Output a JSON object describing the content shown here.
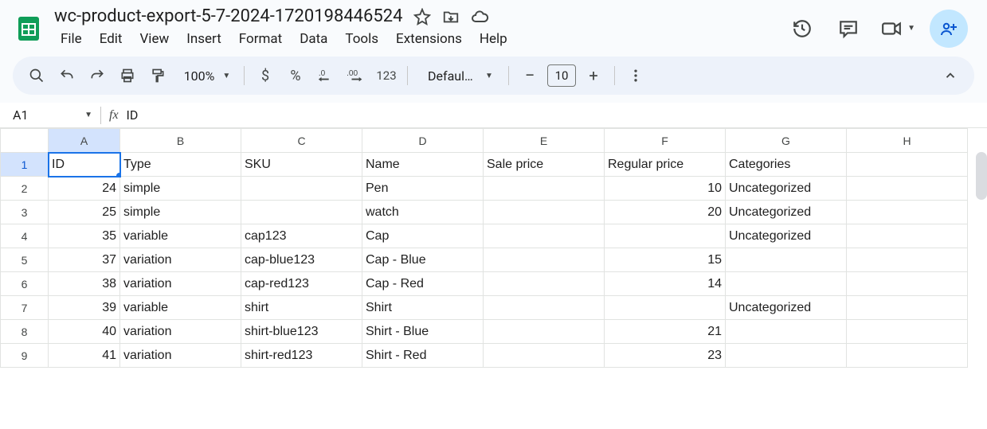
{
  "doc": {
    "title": "wc-product-export-5-7-2024-1720198446524"
  },
  "menu": {
    "file": "File",
    "edit": "Edit",
    "view": "View",
    "insert": "Insert",
    "format": "Format",
    "data": "Data",
    "tools": "Tools",
    "extensions": "Extensions",
    "help": "Help"
  },
  "toolbar": {
    "zoom": "100%",
    "currency": "$",
    "percent": "%",
    "dec_dec": ".0",
    "inc_dec": ".00",
    "numfmt": "123",
    "font": "Defaul...",
    "font_size": "10"
  },
  "namebox": {
    "cell": "A1",
    "formula": "ID"
  },
  "columns": [
    "A",
    "B",
    "C",
    "D",
    "E",
    "F",
    "G",
    "H"
  ],
  "row_numbers": [
    "1",
    "2",
    "3",
    "4",
    "5",
    "6",
    "7",
    "8",
    "9"
  ],
  "grid": [
    {
      "A": "ID",
      "B": "Type",
      "C": "SKU",
      "D": "Name",
      "E": "Sale price",
      "F": "Regular price",
      "G": "Categories",
      "H": ""
    },
    {
      "A": "24",
      "B": "simple",
      "C": "",
      "D": "Pen",
      "E": "",
      "F": "10",
      "G": "Uncategorized",
      "H": ""
    },
    {
      "A": "25",
      "B": "simple",
      "C": "",
      "D": "watch",
      "E": "",
      "F": "20",
      "G": "Uncategorized",
      "H": ""
    },
    {
      "A": "35",
      "B": "variable",
      "C": "cap123",
      "D": "Cap",
      "E": "",
      "F": "",
      "G": "Uncategorized",
      "H": ""
    },
    {
      "A": "37",
      "B": "variation",
      "C": "cap-blue123",
      "D": "Cap - Blue",
      "E": "",
      "F": "15",
      "G": "",
      "H": ""
    },
    {
      "A": "38",
      "B": "variation",
      "C": "cap-red123",
      "D": "Cap - Red",
      "E": "",
      "F": "14",
      "G": "",
      "H": ""
    },
    {
      "A": "39",
      "B": "variable",
      "C": "shirt",
      "D": "Shirt",
      "E": "",
      "F": "",
      "G": "Uncategorized",
      "H": ""
    },
    {
      "A": "40",
      "B": "variation",
      "C": "shirt-blue123",
      "D": "Shirt - Blue",
      "E": "",
      "F": "21",
      "G": "",
      "H": ""
    },
    {
      "A": "41",
      "B": "variation",
      "C": "shirt-red123",
      "D": "Shirt - Red",
      "E": "",
      "F": "23",
      "G": "",
      "H": ""
    }
  ],
  "numeric_cols_after_header": [
    "A",
    "F"
  ]
}
